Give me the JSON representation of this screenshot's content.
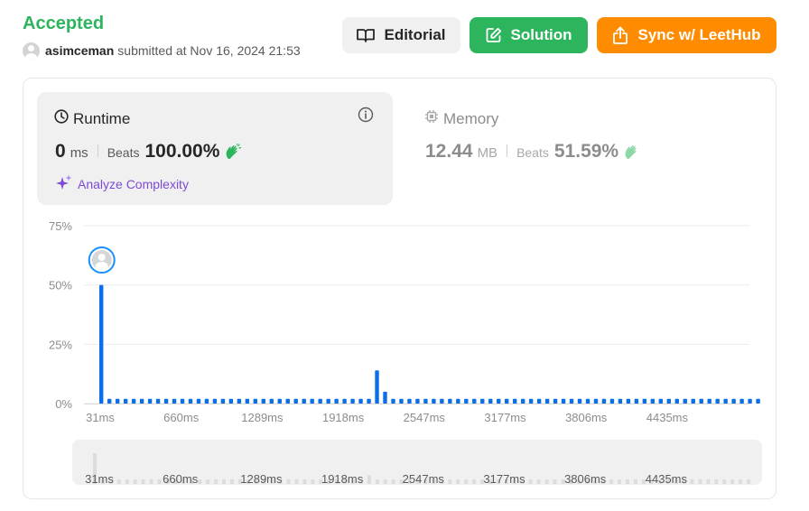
{
  "submission": {
    "status": "Accepted",
    "user": "asimceman",
    "submitted_text": "submitted at Nov 16, 2024 21:53"
  },
  "buttons": {
    "editorial": "Editorial",
    "solution": "Solution",
    "sync": "Sync w/ LeetHub"
  },
  "runtime": {
    "title": "Runtime",
    "value": "0",
    "unit": "ms",
    "beats_label": "Beats",
    "beats_pct": "100.00%",
    "analyze": "Analyze Complexity"
  },
  "memory": {
    "title": "Memory",
    "value": "12.44",
    "unit": "MB",
    "beats_label": "Beats",
    "beats_pct": "51.59%"
  },
  "colors": {
    "accepted": "#2db55d",
    "solution_button": "#2db55d",
    "sync_button": "#ff8c00",
    "bar": "#0a6fe8",
    "analyze": "#7c4ad6"
  },
  "icons": {
    "editorial": "book-icon",
    "solution": "edit-icon",
    "sync": "share-upload-icon",
    "runtime": "clock-icon",
    "memory": "chip-icon",
    "info": "info-icon",
    "beats": "clapping-hands-icon",
    "analyze": "sparkle-icon"
  },
  "chart_data": {
    "type": "bar",
    "title": "",
    "xlabel": "",
    "ylabel": "",
    "ylim": [
      0,
      75
    ],
    "y_ticks": [
      "75%",
      "50%",
      "25%",
      "0%"
    ],
    "x_ticks": [
      "31ms",
      "660ms",
      "1289ms",
      "1918ms",
      "2547ms",
      "3177ms",
      "3806ms",
      "4435ms"
    ],
    "marker": "your submission at 31ms bin",
    "values": [
      50,
      2,
      2,
      2,
      2,
      2,
      2,
      2,
      2,
      2,
      2,
      2,
      2,
      2,
      2,
      2,
      2,
      2,
      2,
      2,
      2,
      2,
      2,
      2,
      2,
      2,
      2,
      2,
      2,
      2,
      2,
      2,
      2,
      2,
      14,
      5,
      2,
      2,
      2,
      2,
      2,
      2,
      2,
      2,
      2,
      2,
      2,
      2,
      2,
      2,
      2,
      2,
      2,
      2,
      2,
      2,
      2,
      2,
      2,
      2,
      2,
      2,
      2,
      2,
      2,
      2,
      2,
      2,
      2,
      2,
      2,
      2,
      2,
      2,
      2,
      2,
      2,
      2,
      2,
      2,
      2,
      2
    ],
    "grid": true,
    "legend": "none"
  }
}
